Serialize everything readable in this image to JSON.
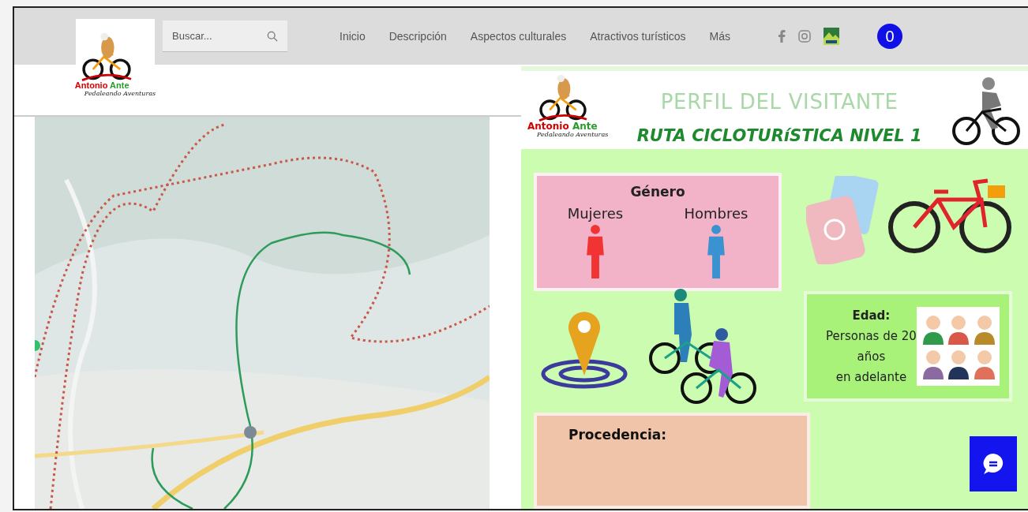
{
  "header": {
    "logo": {
      "name_first": "Antonio",
      "name_second": "Ante",
      "tagline": "Pedaleando Aventuras"
    },
    "search": {
      "placeholder": "Buscar..."
    },
    "nav": [
      {
        "label": "Inicio"
      },
      {
        "label": "Descripción"
      },
      {
        "label": "Aspectos culturales"
      },
      {
        "label": "Atractivos turísticos"
      },
      {
        "label": "Más"
      }
    ],
    "cart": {
      "count": "0"
    }
  },
  "infographic": {
    "title": "PERFIL DEL VISITANTE",
    "logo": {
      "name_first": "Antonio",
      "name_second": "Ante",
      "tagline": "Pedaleando Aventuras"
    },
    "subtitle": "RUTA CICLOTURíSTICA NIVEL 1",
    "gender": {
      "heading": "Género",
      "labels": [
        "Mujeres",
        "Hombres"
      ]
    },
    "age": {
      "heading": "Edad:",
      "lines": [
        "Personas de 20",
        "años",
        "en adelante"
      ]
    },
    "origin": {
      "heading": "Procedencia:"
    }
  }
}
